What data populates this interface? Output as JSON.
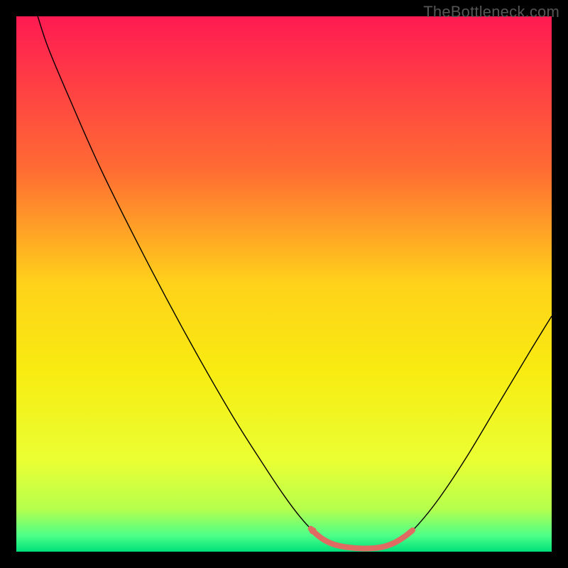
{
  "watermark": "TheBottleneck.com",
  "chart_data": {
    "type": "line",
    "title": "",
    "xlabel": "",
    "ylabel": "",
    "xlim": [
      0,
      100
    ],
    "ylim": [
      0,
      100
    ],
    "background_gradient": {
      "stops": [
        {
          "offset": 0.0,
          "color": "#ff1a52"
        },
        {
          "offset": 0.29,
          "color": "#ff6d33"
        },
        {
          "offset": 0.5,
          "color": "#ffd21a"
        },
        {
          "offset": 0.66,
          "color": "#f8eb11"
        },
        {
          "offset": 0.83,
          "color": "#eaff33"
        },
        {
          "offset": 0.92,
          "color": "#b6ff4d"
        },
        {
          "offset": 0.97,
          "color": "#4dff88"
        },
        {
          "offset": 1.0,
          "color": "#00e07a"
        }
      ]
    },
    "series": [
      {
        "name": "bottleneck-curve",
        "color": "#000000",
        "width": 1.4,
        "points": [
          {
            "x": 4.0,
            "y": 100.0
          },
          {
            "x": 6.0,
            "y": 94.0
          },
          {
            "x": 10.0,
            "y": 84.5
          },
          {
            "x": 16.0,
            "y": 71.0
          },
          {
            "x": 24.0,
            "y": 55.0
          },
          {
            "x": 32.0,
            "y": 40.0
          },
          {
            "x": 40.0,
            "y": 26.0
          },
          {
            "x": 46.0,
            "y": 16.5
          },
          {
            "x": 50.0,
            "y": 10.5
          },
          {
            "x": 53.0,
            "y": 6.5
          },
          {
            "x": 55.5,
            "y": 3.8
          },
          {
            "x": 58.0,
            "y": 2.0
          },
          {
            "x": 61.0,
            "y": 1.0
          },
          {
            "x": 64.0,
            "y": 0.6
          },
          {
            "x": 67.0,
            "y": 0.6
          },
          {
            "x": 70.0,
            "y": 1.3
          },
          {
            "x": 72.5,
            "y": 2.8
          },
          {
            "x": 75.0,
            "y": 5.0
          },
          {
            "x": 79.0,
            "y": 10.0
          },
          {
            "x": 84.0,
            "y": 17.5
          },
          {
            "x": 90.0,
            "y": 27.5
          },
          {
            "x": 96.0,
            "y": 37.5
          },
          {
            "x": 100.0,
            "y": 44.0
          }
        ]
      },
      {
        "name": "highlight-segment",
        "color": "#e06b63",
        "width": 8,
        "cap": "round",
        "points": [
          {
            "x": 55.0,
            "y": 4.3
          },
          {
            "x": 55.9,
            "y": 3.4
          },
          {
            "x": 57.5,
            "y": 2.2
          },
          {
            "x": 59.5,
            "y": 1.3
          },
          {
            "x": 62.0,
            "y": 0.8
          },
          {
            "x": 65.0,
            "y": 0.6
          },
          {
            "x": 68.0,
            "y": 0.8
          },
          {
            "x": 70.5,
            "y": 1.6
          },
          {
            "x": 72.5,
            "y": 2.8
          },
          {
            "x": 74.0,
            "y": 4.0
          }
        ]
      },
      {
        "name": "highlight-dot",
        "type": "marker",
        "color": "#e06b63",
        "radius": 5,
        "x": 55.4,
        "y": 3.9
      }
    ]
  }
}
